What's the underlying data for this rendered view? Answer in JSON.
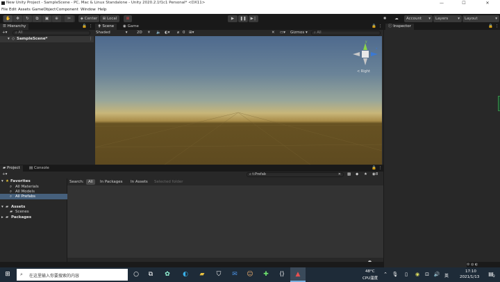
{
  "window": {
    "title": "New Unity Project - SampleScene - PC, Mac & Linux Standalone - Unity 2020.2.1f1c1 Personal* <DX11>",
    "minimize": "—",
    "maximize": "☐",
    "close": "✕"
  },
  "menu": [
    "File",
    "Edit",
    "Assets",
    "GameObject",
    "Component",
    "Window",
    "Help"
  ],
  "toolbar": {
    "pivot_label": "Center",
    "space_label": "Local",
    "account_label": "Account",
    "layers_label": "Layers",
    "layout_label": "Layout"
  },
  "hierarchy": {
    "tab": "Hierarchy",
    "search_placeholder": "All",
    "scene_item": "SampleScene*"
  },
  "scene": {
    "tab_scene": "Scene",
    "tab_game": "Game",
    "shading": "Shaded",
    "mode_2d": "2D",
    "fx_count": "0",
    "gizmos": "Gizmos",
    "search_placeholder": "All",
    "gizmo_label": "< Right",
    "axis_y": "y",
    "axis_x": "x"
  },
  "inspector": {
    "tab": "Inspector"
  },
  "project": {
    "tab_project": "Project",
    "tab_console": "Console",
    "search_value": "t:Prefab",
    "hidden_count": "8",
    "search_label": "Search:",
    "scope_all": "All",
    "scope_packages": "In Packages",
    "scope_assets": "In Assets",
    "scope_selected": "Selected folder",
    "favorites": "Favorites",
    "fav_items": [
      "All Materials",
      "All Models",
      "All Prefabs"
    ],
    "assets": "Assets",
    "scenes": "Scenes",
    "packages": "Packages"
  },
  "taskbar": {
    "search_placeholder": "在这里输入你要搜索的内容",
    "weather": "48°C",
    "weather_sub": "CPU温度",
    "ime": "英",
    "time": "17:10",
    "date": "2021/1/13",
    "notif_count": "2"
  },
  "colors": {
    "accent": "#3a79d6",
    "tab_active": "#282828",
    "taskbar": "#1e2b38",
    "selected_item": "#46607c"
  }
}
